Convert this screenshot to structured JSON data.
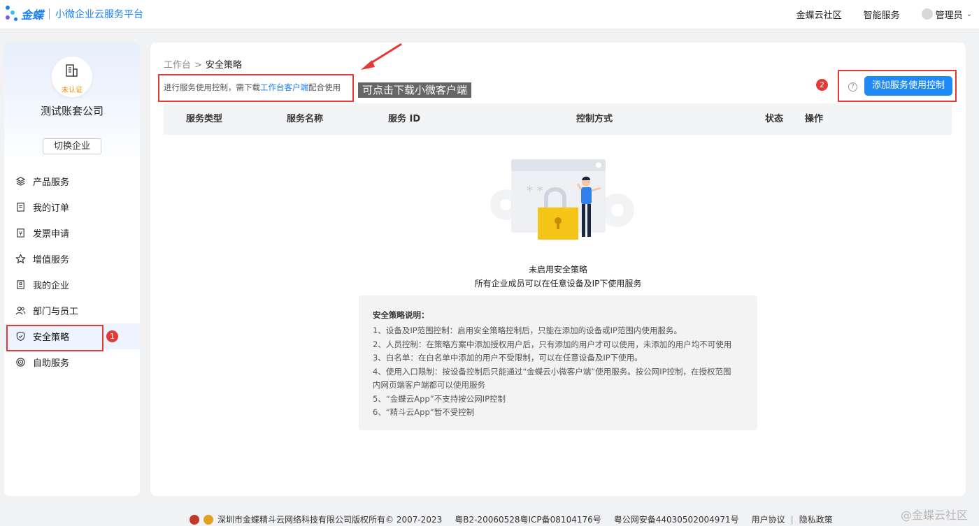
{
  "header": {
    "brand": "金蝶",
    "platform": "小微企业云服务平台",
    "links": [
      "金蝶云社区",
      "智能服务"
    ],
    "user": "管理员",
    "accent": "#1a7ff0"
  },
  "sidebar": {
    "cert_status": "未认证",
    "company_name": "测试账套公司",
    "switch_label": "切换企业",
    "items": [
      {
        "label": "产品服务",
        "icon": "layers-icon"
      },
      {
        "label": "我的订单",
        "icon": "document-icon"
      },
      {
        "label": "发票申请",
        "icon": "invoice-icon"
      },
      {
        "label": "增值服务",
        "icon": "star-icon"
      },
      {
        "label": "我的企业",
        "icon": "building-icon"
      },
      {
        "label": "部门与员工",
        "icon": "users-icon"
      },
      {
        "label": "安全策略",
        "icon": "shield-icon",
        "active": true
      },
      {
        "label": "自助服务",
        "icon": "target-icon"
      }
    ]
  },
  "main": {
    "breadcrumb": {
      "root": "工作台",
      "separator": ">",
      "current": "安全策略"
    },
    "notice": {
      "prefix": "进行服务使用控制，需下载",
      "link": "工作台客户端",
      "suffix": "配合使用"
    },
    "help_symbol": "?",
    "add_button": "添加服务使用控制",
    "table_headers": [
      "服务类型",
      "服务名称",
      "服务 ID",
      "控制方式",
      "状态",
      "操作"
    ],
    "empty": {
      "title": "未启用安全策略",
      "subtitle": "所有企业成员可以在任意设备及IP下使用服务"
    },
    "policy": {
      "title": "安全策略说明：",
      "lines": [
        "1、设备及IP范围控制：启用安全策略控制后，只能在添加的设备或IP范围内使用服务。",
        "2、人员控制：在策略方案中添加授权用户后，只有添加的用户才可以使用，未添加的用户均不可使用",
        "3、白名单：在白名单中添加的用户不受限制，可以在任意设备及IP下使用。",
        "4、使用入口限制：按设备控制后只能通过“金蝶云小微客户端”使用服务。按公网IP控制，在授权范围",
        "内网页端客户端都可以使用服务",
        "5、“金蝶云App”不支持按公网IP控制",
        "6、“精斗云App”暂不受控制"
      ]
    }
  },
  "annotations": {
    "tip": "可点击下载小微客户端",
    "badge_1": "1",
    "badge_2": "2",
    "color": "#e53935"
  },
  "footer": {
    "copyright": "深圳市金蝶精斗云网络科技有限公司版权所有© 2007-2023",
    "icp": "粤B2-20060528粤ICP备08104176号",
    "police": "粤公网安备44030502004971号",
    "links": [
      "用户协议",
      "隐私政策"
    ],
    "separator": "|",
    "watermark": "@金蝶云社区"
  }
}
